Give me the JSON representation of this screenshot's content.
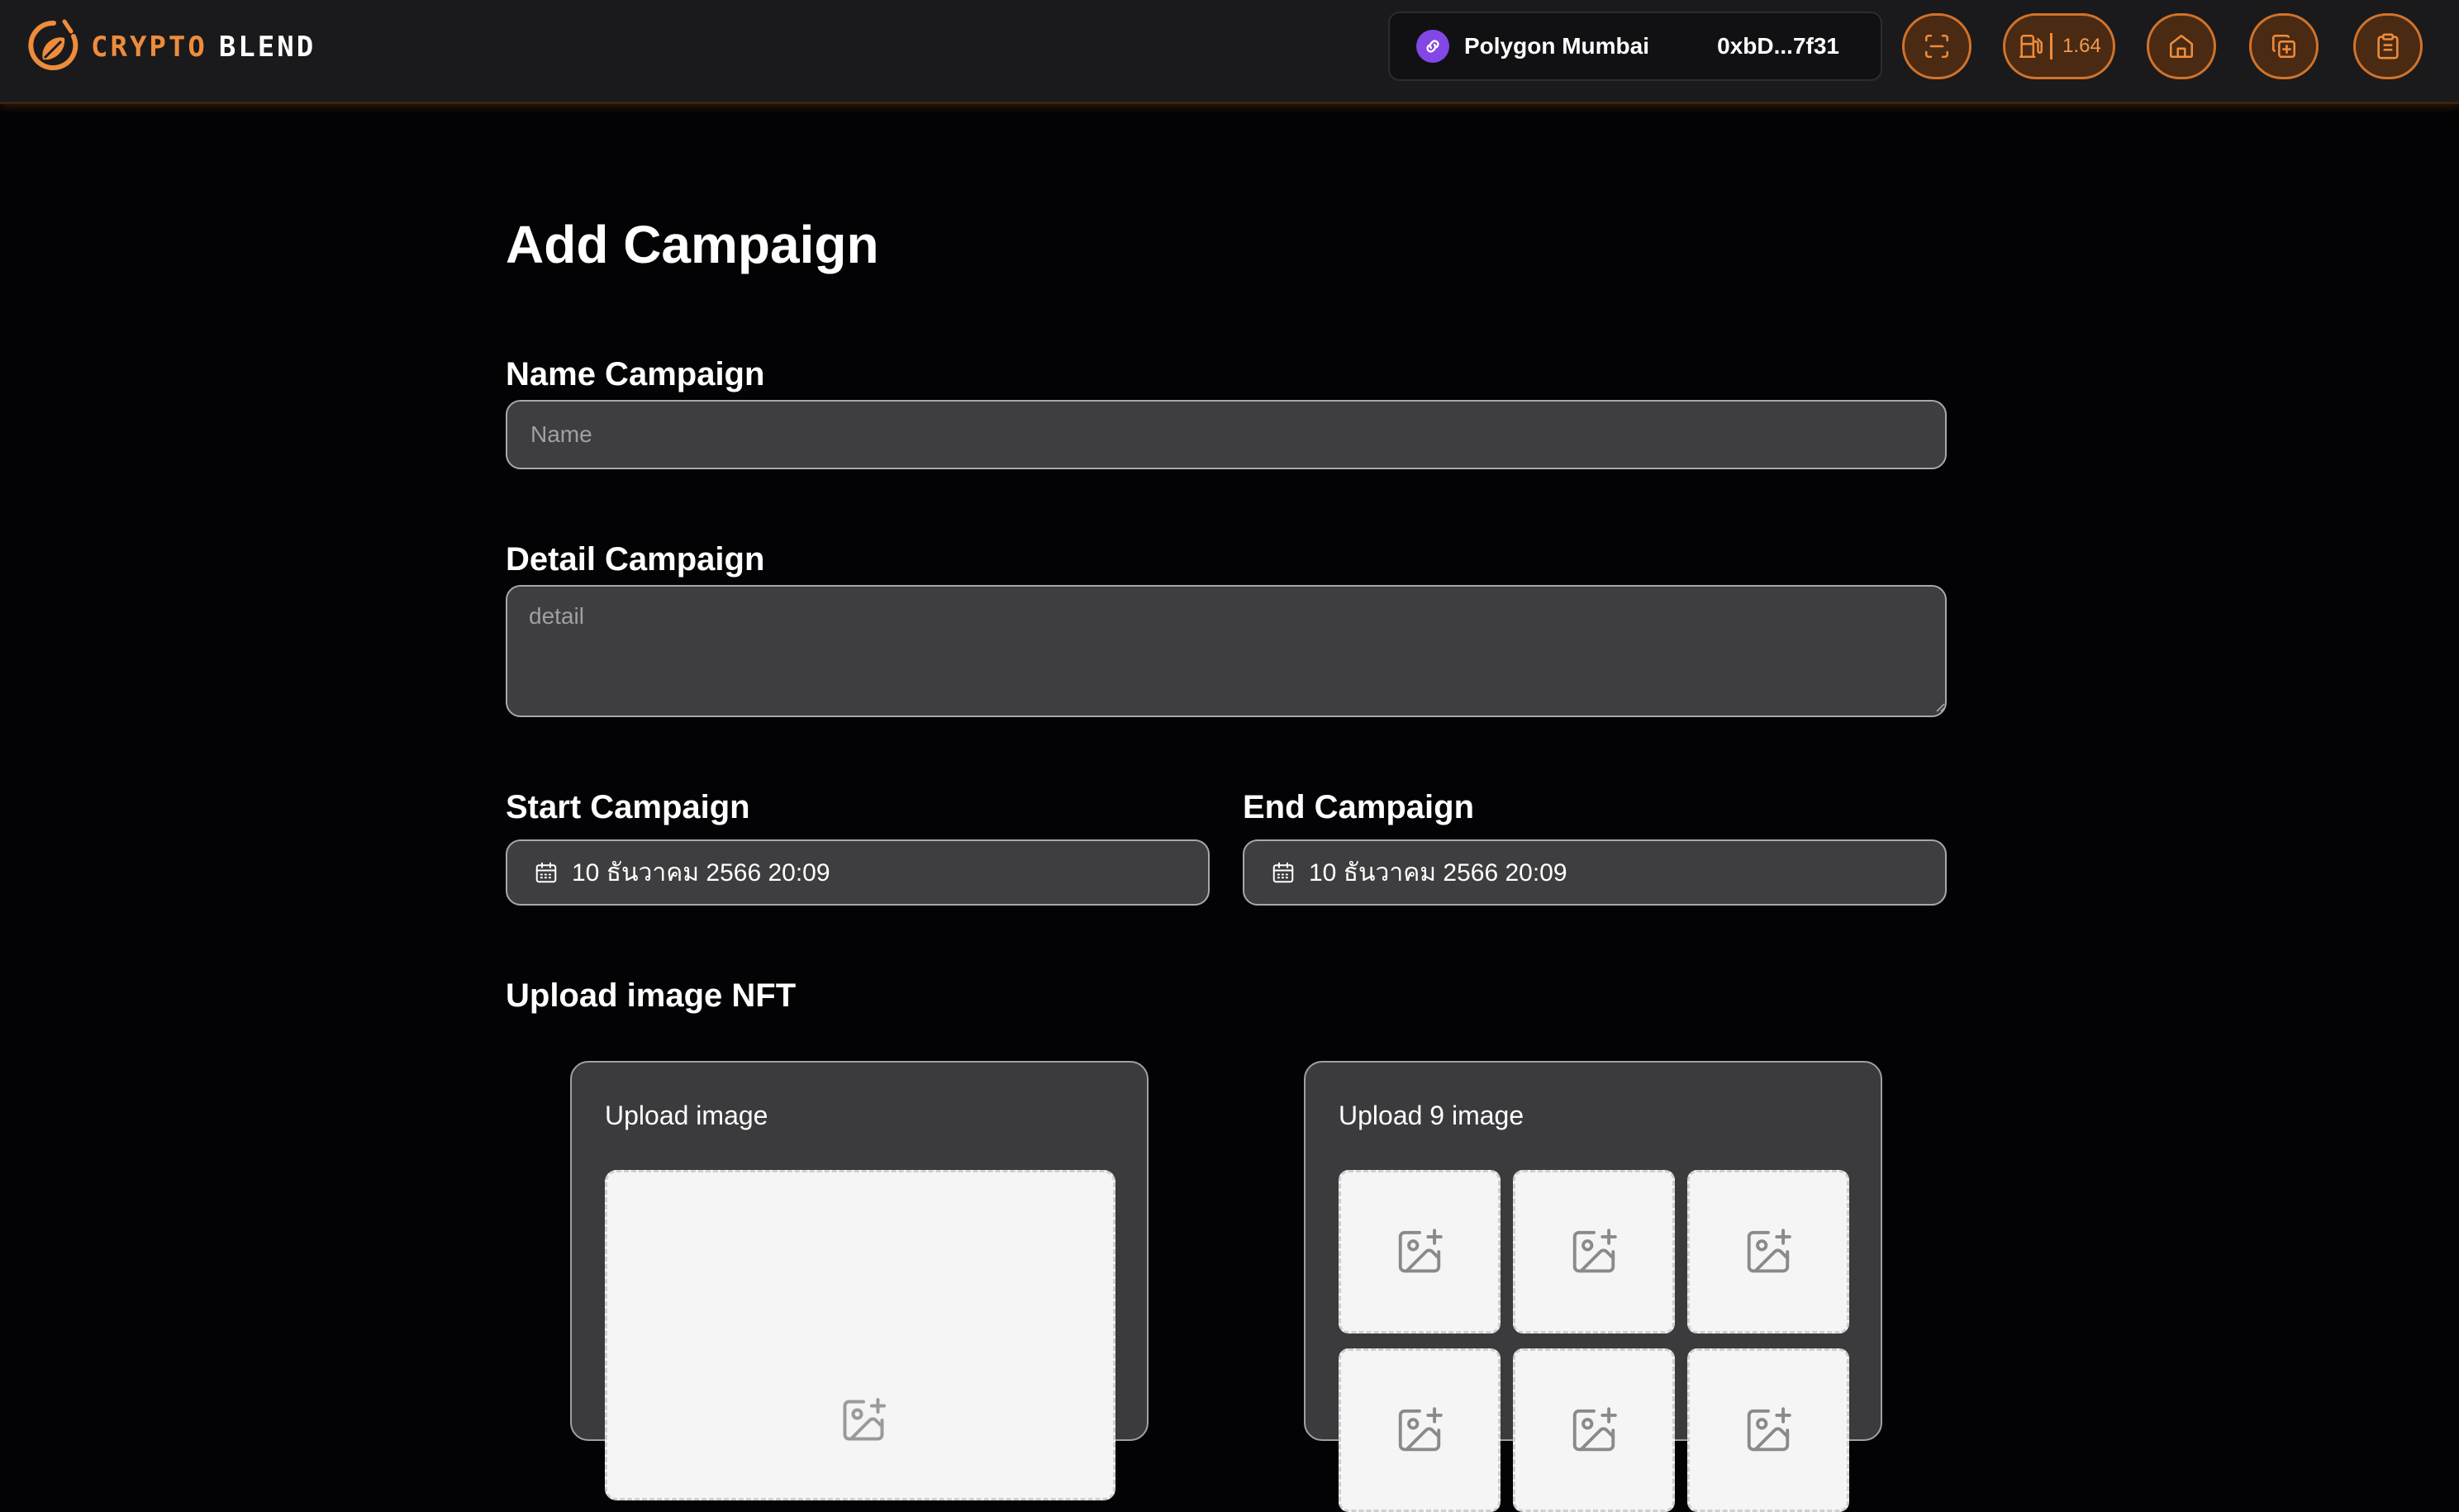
{
  "app": {
    "logo_text_a": "CRYPTO",
    "logo_text_b": "BLEND",
    "brand_color": "#ee8c3c"
  },
  "header": {
    "network_name": "Polygon Mumbai",
    "network_icon": "polygon-link-icon",
    "wallet_address": "0xbD...7f31",
    "gas_value": "1.64",
    "buttons": [
      {
        "name": "scan-button",
        "icon": "scan-icon"
      },
      {
        "name": "gas-button",
        "icon": "fuel-pump-icon"
      },
      {
        "name": "home-button",
        "icon": "home-icon"
      },
      {
        "name": "add-campaign-button",
        "icon": "copy-plus-icon"
      },
      {
        "name": "clipboard-button",
        "icon": "clipboard-icon"
      }
    ]
  },
  "form": {
    "title": "Add Campaign",
    "name_label": "Name Campaign",
    "name_placeholder": "Name",
    "name_value": "",
    "detail_label": "Detail Campaign",
    "detail_placeholder": "detail",
    "detail_value": "",
    "start_label": "Start Campaign",
    "start_value": "10 ธันวาคม 2566 20:09",
    "end_label": "End Campaign",
    "end_value": "10 ธันวาคม 2566 20:09"
  },
  "upload": {
    "title": "Upload image NFT",
    "single_label": "Upload image",
    "multi_label": "Upload 9 image",
    "tile_icon": "image-plus-icon"
  }
}
